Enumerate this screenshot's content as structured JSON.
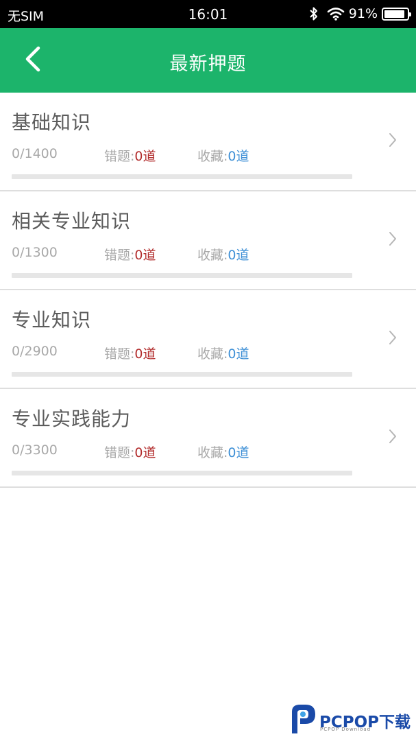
{
  "status_bar": {
    "carrier": "无SIM",
    "time": "16:01",
    "battery_percent": "91%",
    "battery_level": 0.91
  },
  "header": {
    "title": "最新押题",
    "back_icon": "chevron-left-icon",
    "bg_color": "#1cb46b"
  },
  "categories": [
    {
      "title": "基础知识",
      "progress": "0/1400",
      "wrong_label": "错题:",
      "wrong_value": "0道",
      "fav_label": "收藏:",
      "fav_value": "0道",
      "completed_fraction": 0
    },
    {
      "title": "相关专业知识",
      "progress": "0/1300",
      "wrong_label": "错题:",
      "wrong_value": "0道",
      "fav_label": "收藏:",
      "fav_value": "0道",
      "completed_fraction": 0
    },
    {
      "title": "专业知识",
      "progress": "0/2900",
      "wrong_label": "错题:",
      "wrong_value": "0道",
      "fav_label": "收藏:",
      "fav_value": "0道",
      "completed_fraction": 0
    },
    {
      "title": "专业实践能力",
      "progress": "0/3300",
      "wrong_label": "错题:",
      "wrong_value": "0道",
      "fav_label": "收藏:",
      "fav_value": "0道",
      "completed_fraction": 0
    }
  ],
  "colors": {
    "accent": "#1cb46b",
    "wrong": "#b22c2c",
    "favorite": "#3d8fd6"
  },
  "watermark": {
    "logo": "PCPOP下载",
    "subtitle": "PCPOP Download"
  }
}
